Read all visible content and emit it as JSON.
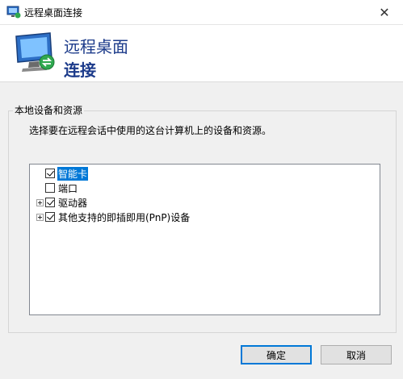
{
  "window": {
    "title": "远程桌面连接"
  },
  "header": {
    "line1": "远程桌面",
    "line2": "连接"
  },
  "group": {
    "legend": "本地设备和资源",
    "description": "选择要在远程会话中使用的这台计算机上的设备和资源。"
  },
  "tree": {
    "items": [
      {
        "label": "智能卡",
        "checked": true,
        "expandable": false,
        "selected": true
      },
      {
        "label": "端口",
        "checked": false,
        "expandable": false,
        "selected": false
      },
      {
        "label": "驱动器",
        "checked": true,
        "expandable": true,
        "selected": false
      },
      {
        "label": "其他支持的即插即用(PnP)设备",
        "checked": true,
        "expandable": true,
        "selected": false
      }
    ]
  },
  "buttons": {
    "ok": "确定",
    "cancel": "取消"
  },
  "icons": {
    "app": "remote-desktop-icon",
    "close": "close-icon",
    "expand": "plus-expander-icon",
    "check": "checkbox-icon"
  }
}
